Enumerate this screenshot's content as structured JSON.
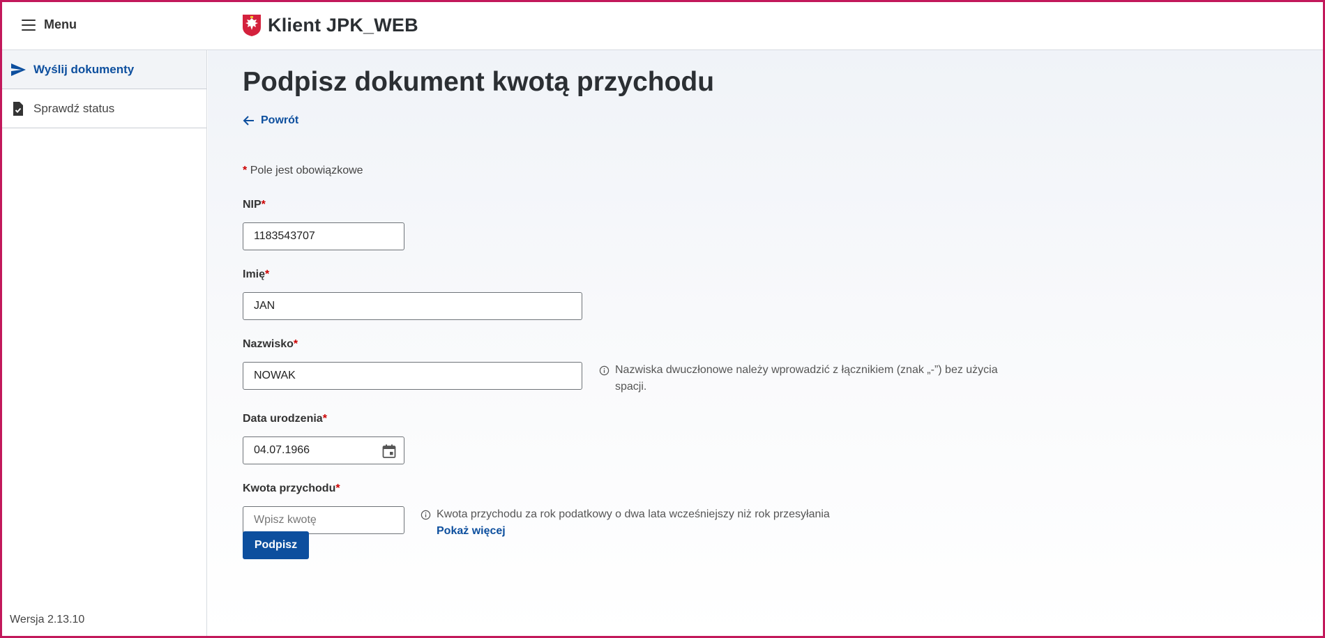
{
  "header": {
    "menu_label": "Menu",
    "app_title": "Klient JPK_WEB"
  },
  "sidebar": {
    "items": [
      {
        "label": "Wyślij dokumenty",
        "icon": "send-icon",
        "active": true
      },
      {
        "label": "Sprawdź status",
        "icon": "document-check-icon",
        "active": false
      }
    ],
    "version": "Wersja 2.13.10"
  },
  "main": {
    "title": "Podpisz dokument kwotą przychodu",
    "back_label": "Powrót",
    "required_note": "Pole jest obowiązkowe",
    "required_mark": "*",
    "fields": {
      "nip": {
        "label": "NIP",
        "value": "1183543707"
      },
      "imie": {
        "label": "Imię",
        "value": "JAN"
      },
      "nazwisko": {
        "label": "Nazwisko",
        "value": "NOWAK",
        "hint": "Nazwiska dwuczłonowe należy wprowadzić z łącznikiem (znak „-”) bez użycia spacji."
      },
      "data_urodzenia": {
        "label": "Data urodzenia",
        "value": "04.07.1966"
      },
      "kwota": {
        "label": "Kwota przychodu",
        "placeholder": "Wpisz kwotę",
        "hint": "Kwota przychodu za rok podatkowy o dwa lata wcześniejszy niż rok przesyłania",
        "more_link": "Pokaż więcej"
      }
    },
    "submit_label": "Podpisz"
  },
  "colors": {
    "accent": "#0d4f9e",
    "required": "#cc0000",
    "frame_border": "#c2185b"
  }
}
